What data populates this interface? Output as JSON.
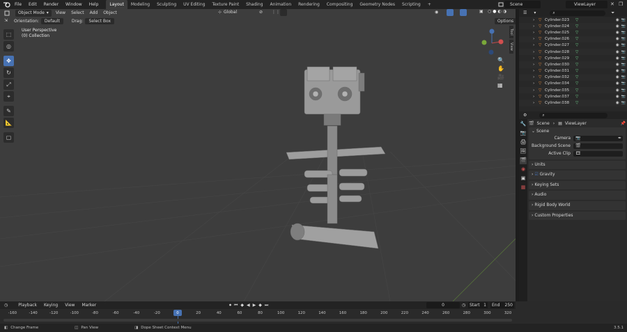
{
  "menus": [
    "File",
    "Edit",
    "Render",
    "Window",
    "Help"
  ],
  "workspaces": [
    {
      "label": "Layout",
      "active": true
    },
    {
      "label": "Modeling"
    },
    {
      "label": "Sculpting"
    },
    {
      "label": "UV Editing"
    },
    {
      "label": "Texture Paint"
    },
    {
      "label": "Shading"
    },
    {
      "label": "Animation"
    },
    {
      "label": "Rendering"
    },
    {
      "label": "Compositing"
    },
    {
      "label": "Geometry Nodes"
    },
    {
      "label": "Scripting"
    }
  ],
  "add_tab": "+",
  "scene": "Scene",
  "view_layer": "ViewLayer",
  "viewport": {
    "mode": "Object Mode",
    "menus": [
      "View",
      "Select",
      "Add",
      "Object"
    ],
    "transform": "Global",
    "orientation_label": "Orientation:",
    "orientation": "Default",
    "drag_label": "Drag:",
    "drag": "Select Box",
    "options": "Options",
    "info_line1": "User Perspective",
    "info_line2": "(0) Collection",
    "side_tabs": [
      "Tool",
      "View"
    ]
  },
  "outliner": {
    "items": [
      "Cylinder.023",
      "Cylinder.024",
      "Cylinder.025",
      "Cylinder.026",
      "Cylinder.027",
      "Cylinder.028",
      "Cylinder.029",
      "Cylinder.030",
      "Cylinder.031",
      "Cylinder.032",
      "Cylinder.034",
      "Cylinder.035",
      "Cylinder.037",
      "Cylinder.038"
    ]
  },
  "properties": {
    "breadcrumb_scene": "Scene",
    "breadcrumb_layer": "ViewLayer",
    "scene_panel": "Scene",
    "camera_label": "Camera",
    "bg_label": "Background Scene",
    "clip_label": "Active Clip",
    "panels": [
      "Units",
      "Gravity",
      "Keying Sets",
      "Audio",
      "Rigid Body World",
      "Custom Properties"
    ]
  },
  "timeline": {
    "menus": [
      "Playback",
      "Keying",
      "View",
      "Marker"
    ],
    "current": "0",
    "start_label": "Start",
    "start": "1",
    "end_label": "End",
    "end": "250",
    "ticks": [
      "-160",
      "-140",
      "-120",
      "-100",
      "-80",
      "-60",
      "-40",
      "-20",
      "0",
      "20",
      "40",
      "60",
      "80",
      "100",
      "120",
      "140",
      "160",
      "180",
      "200",
      "220",
      "240",
      "260",
      "280",
      "300",
      "320"
    ]
  },
  "status": {
    "left": "Change Frame",
    "middle": "Pan View",
    "right": "Dope Sheet Context Menu",
    "version": "3.5.1"
  },
  "colors": {
    "accent": "#4772b3",
    "vertex_green": "#6fd18b",
    "object_orange": "#e3863a"
  }
}
